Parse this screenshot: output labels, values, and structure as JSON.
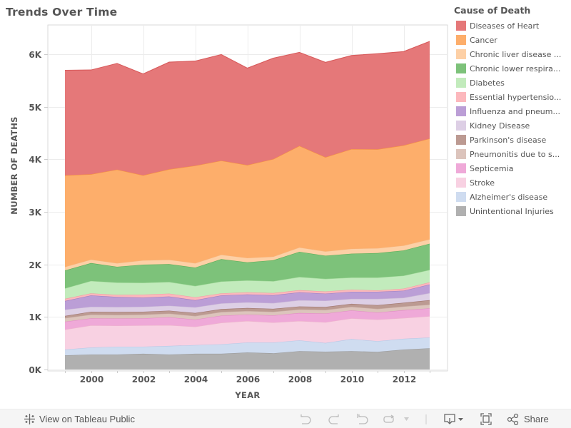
{
  "title": "Trends Over Time",
  "legend": {
    "title": "Cause of Death"
  },
  "toolbar": {
    "view_label": "View on Tableau Public",
    "share_label": "Share",
    "icons": [
      "undo-icon",
      "redo-icon",
      "revert-icon",
      "refresh-icon",
      "dropdown-icon",
      "download-icon",
      "fullscreen-icon",
      "share-icon"
    ]
  },
  "chart_data": {
    "type": "area",
    "stacked": true,
    "title": "Trends Over Time",
    "xlabel": "YEAR",
    "ylabel": "NUMBER OF DEATHS",
    "x": [
      1999,
      2000,
      2001,
      2002,
      2003,
      2004,
      2005,
      2006,
      2007,
      2008,
      2009,
      2010,
      2011,
      2012,
      2013
    ],
    "x_ticks": [
      2000,
      2002,
      2004,
      2006,
      2008,
      2010,
      2012
    ],
    "x_tick_labels": [
      "2000",
      "2002",
      "2004",
      "2006",
      "2008",
      "2010",
      "2012"
    ],
    "xlim": [
      1998.3,
      2013.7
    ],
    "y_ticks": [
      0,
      1000,
      2000,
      3000,
      4000,
      5000,
      6000
    ],
    "y_tick_labels": [
      "0K",
      "1K",
      "2K",
      "3K",
      "4K",
      "5K",
      "6K"
    ],
    "ylim": [
      0,
      6550
    ],
    "grid": true,
    "legend_position": "right",
    "legend_title": "Cause of Death",
    "series": [
      {
        "name": "Unintentional Injuries",
        "label": "Unintentional Injuries",
        "color": "#b0b0b0",
        "stroke": "#9a9a9a",
        "values": [
          270,
          285,
          285,
          300,
          285,
          300,
          300,
          325,
          310,
          350,
          340,
          350,
          335,
          380,
          405
        ]
      },
      {
        "name": "Alzheimer's disease",
        "label": "Alzheimer's disease",
        "color": "#cfdcf0",
        "stroke": "#b5c8e6",
        "values": [
          110,
          135,
          150,
          135,
          165,
          165,
          180,
          190,
          205,
          205,
          165,
          230,
          205,
          205,
          205
        ]
      },
      {
        "name": "Stroke",
        "label": "Stroke",
        "color": "#f8d1e2",
        "stroke": "#eeb5cc",
        "values": [
          380,
          420,
          400,
          405,
          395,
          350,
          410,
          410,
          380,
          370,
          395,
          395,
          410,
          395,
          405
        ]
      },
      {
        "name": "Septicemia",
        "label": "Septicemia",
        "color": "#efa9d8",
        "stroke": "#e28ac5",
        "values": [
          150,
          135,
          135,
          135,
          150,
          135,
          135,
          120,
          135,
          150,
          165,
          150,
          135,
          150,
          150
        ]
      },
      {
        "name": "Pneumonitis due to solids and liquids",
        "label": "Pneumonitis due to s...",
        "color": "#dcc4bc",
        "stroke": "#c9aca2",
        "values": [
          70,
          70,
          70,
          70,
          70,
          70,
          70,
          70,
          70,
          70,
          70,
          70,
          70,
          70,
          70
        ]
      },
      {
        "name": "Parkinson's disease",
        "label": "Parkinson's disease",
        "color": "#bc9a92",
        "stroke": "#a0756d",
        "values": [
          40,
          55,
          55,
          55,
          55,
          55,
          55,
          55,
          55,
          55,
          55,
          55,
          70,
          70,
          85
        ]
      },
      {
        "name": "Kidney Disease",
        "label": "Kidney Disease",
        "color": "#ddcfe5",
        "stroke": "#c9b6d6",
        "values": [
          120,
          95,
          95,
          95,
          95,
          110,
          110,
          110,
          110,
          120,
          120,
          95,
          120,
          95,
          135
        ]
      },
      {
        "name": "Influenza and pneumonia",
        "label": "Influenza and pneum...",
        "color": "#bb9ed6",
        "stroke": "#9d7cc2",
        "values": [
          165,
          215,
          190,
          175,
          175,
          135,
          150,
          150,
          150,
          150,
          135,
          135,
          135,
          135,
          165
        ]
      },
      {
        "name": "Essential hypertension",
        "label": "Essential hypertensio...",
        "color": "#fcb8bd",
        "stroke": "#f39aa1",
        "values": [
          40,
          40,
          40,
          55,
          55,
          55,
          40,
          40,
          40,
          40,
          40,
          40,
          25,
          40,
          40
        ]
      },
      {
        "name": "Diabetes",
        "label": "Diabetes",
        "color": "#c2ebbc",
        "stroke": "#a6dc9e",
        "values": [
          200,
          235,
          235,
          225,
          220,
          215,
          225,
          225,
          225,
          250,
          240,
          230,
          245,
          245,
          235
        ]
      },
      {
        "name": "Chronic lower respiratory diseases",
        "label": "Chronic lower respira...",
        "color": "#7dc27a",
        "stroke": "#5aad57",
        "values": [
          340,
          340,
          300,
          345,
          340,
          350,
          425,
          345,
          400,
          480,
          440,
          455,
          465,
          480,
          500
        ]
      },
      {
        "name": "Chronic liver disease and cirrhosis",
        "label": "Chronic liver disease ...",
        "color": "#fdd0a6",
        "stroke": "#f7b57c",
        "values": [
          70,
          70,
          70,
          85,
          85,
          85,
          85,
          85,
          70,
          85,
          85,
          95,
          95,
          95,
          85
        ]
      },
      {
        "name": "Cancer",
        "label": "Cancer",
        "color": "#fdae6b",
        "stroke": "#f5933f",
        "values": [
          1740,
          1620,
          1780,
          1615,
          1720,
          1855,
          1790,
          1765,
          1855,
          1930,
          1790,
          1895,
          1880,
          1905,
          1915
        ]
      },
      {
        "name": "Diseases of Heart",
        "label": "Diseases of Heart",
        "color": "#e57879",
        "stroke": "#d85b5c",
        "values": [
          2000,
          1985,
          2020,
          1930,
          2040,
          1990,
          2020,
          1845,
          1920,
          1780,
          1805,
          1780,
          1820,
          1785,
          1850
        ]
      }
    ]
  }
}
